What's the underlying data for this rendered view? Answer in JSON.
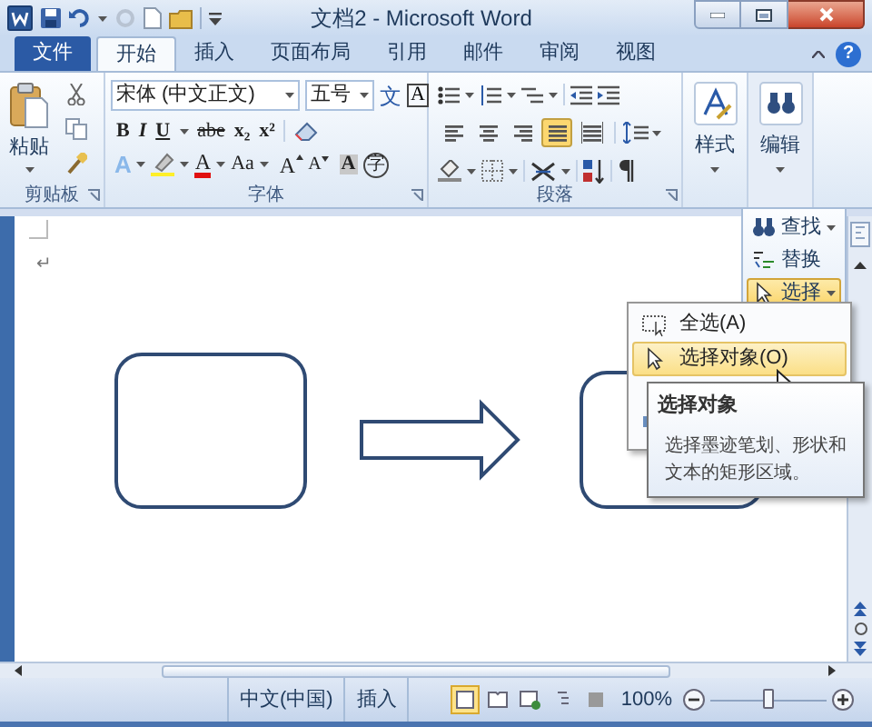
{
  "window": {
    "title": "文档2 - Microsoft Word"
  },
  "tabs": [
    {
      "label": "文件",
      "kind": "file",
      "selected": false
    },
    {
      "label": "开始",
      "kind": "tab",
      "selected": true
    },
    {
      "label": "插入",
      "kind": "tab",
      "selected": false
    },
    {
      "label": "页面布局",
      "kind": "tab",
      "selected": false
    },
    {
      "label": "引用",
      "kind": "tab",
      "selected": false
    },
    {
      "label": "邮件",
      "kind": "tab",
      "selected": false
    },
    {
      "label": "审阅",
      "kind": "tab",
      "selected": false
    },
    {
      "label": "视图",
      "kind": "tab",
      "selected": false
    }
  ],
  "help_button": "?",
  "clipboard": {
    "paste_label": "粘贴",
    "group_label": "剪贴板"
  },
  "font": {
    "name": "宋体 (中文正文)",
    "size": "五号",
    "group_label": "字体",
    "row1_buttons": [
      {
        "kind": "phonetic",
        "text": "文"
      },
      {
        "kind": "border",
        "text": "A"
      }
    ],
    "row2_buttons": [
      {
        "kind": "bold",
        "text": "B"
      },
      {
        "kind": "italic",
        "text": "I"
      },
      {
        "kind": "underline",
        "text": "U"
      },
      {
        "kind": "strike",
        "text": "abe"
      },
      {
        "kind": "subscript",
        "text": "x₂"
      },
      {
        "kind": "superscript",
        "text": "x²"
      }
    ],
    "row3_buttons": [
      {
        "kind": "effect",
        "text": "A"
      },
      {
        "kind": "highlight"
      },
      {
        "kind": "color",
        "text": "A"
      },
      {
        "kind": "case",
        "text": "Aa"
      },
      {
        "kind": "grow",
        "text": "A"
      },
      {
        "kind": "shrink",
        "text": "A"
      },
      {
        "kind": "shade",
        "text": "A"
      },
      {
        "kind": "enclose",
        "text": "字"
      }
    ]
  },
  "paragraph": {
    "group_label": "段落",
    "alignment": [
      {
        "kind": "left",
        "selected": false
      },
      {
        "kind": "center",
        "selected": false
      },
      {
        "kind": "right",
        "selected": false
      },
      {
        "kind": "justify",
        "selected": true
      },
      {
        "kind": "distributed",
        "selected": false
      }
    ]
  },
  "styles": {
    "label": "样式"
  },
  "editing": {
    "label": "编辑",
    "items": [
      {
        "kind": "find",
        "label": "查找",
        "selected": false
      },
      {
        "kind": "replace",
        "label": "替换",
        "selected": false
      },
      {
        "kind": "select",
        "label": "选择",
        "selected": true
      }
    ]
  },
  "document": {
    "paragraph_mark": "↵"
  },
  "select_menu": [
    {
      "kind": "select-all",
      "label": "全选(A)",
      "selected": false
    },
    {
      "kind": "select-objects",
      "label": "选择对象(O)",
      "selected": true
    },
    {
      "kind": "hidden"
    },
    {
      "kind": "selection-pane"
    }
  ],
  "tooltip": {
    "title": "选择对象",
    "text": "选择墨迹笔划、形状和文本的矩形区域。"
  },
  "status_bar": {
    "language": "中文(中国)",
    "mode": "插入",
    "zoom": "100%",
    "views": [
      {
        "kind": "print",
        "selected": true
      },
      {
        "kind": "read",
        "selected": false
      },
      {
        "kind": "web",
        "selected": false
      },
      {
        "kind": "outline",
        "selected": false
      },
      {
        "kind": "draft",
        "selected": false
      }
    ],
    "zoom_slider": {
      "level": 0.5
    }
  }
}
